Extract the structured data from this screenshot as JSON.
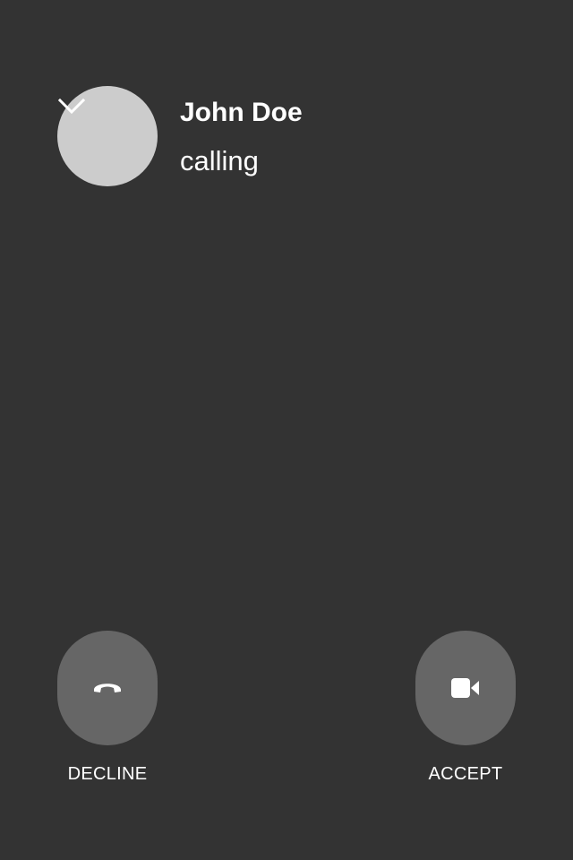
{
  "caller": {
    "name": "John Doe",
    "status": "calling",
    "avatar_color": "#cccccc"
  },
  "header": {
    "minimize_icon": "chevron-down-icon"
  },
  "actions": {
    "decline": {
      "label": "DECLINE",
      "icon": "phone-hangup-icon"
    },
    "accept": {
      "label": "ACCEPT",
      "icon": "video-camera-icon"
    }
  },
  "colors": {
    "background": "#333333",
    "button": "#666666",
    "text": "#ffffff"
  }
}
